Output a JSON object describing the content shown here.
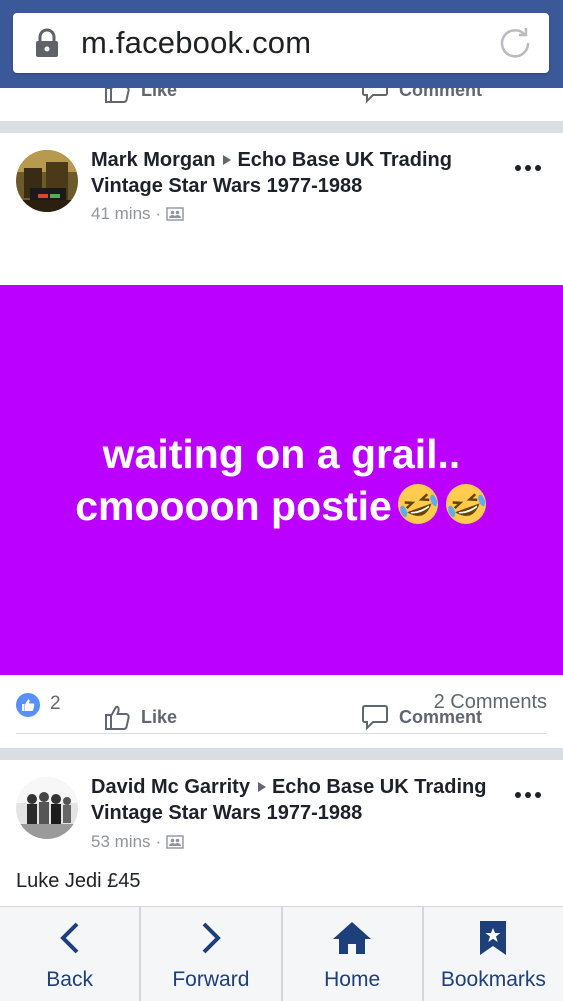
{
  "browser": {
    "url": "m.facebook.com"
  },
  "partial_post_actions": {
    "like_label": "Like",
    "comment_label": "Comment"
  },
  "post1": {
    "author": "Mark Morgan",
    "group": "Echo Base UK Trading",
    "group_line2": "Vintage Star Wars 1977-1988",
    "time": "41 mins",
    "text_line1": "waiting on a grail..",
    "text_line2": "cmoooon postie",
    "background_color": "#bb00ff",
    "emoji": [
      "rolling-on-floor-laughing",
      "rolling-on-floor-laughing"
    ],
    "like_count": "2",
    "comment_count": "2 Comments",
    "like_label": "Like",
    "comment_label": "Comment"
  },
  "post2": {
    "author": "David Mc Garrity",
    "group": "Echo Base UK Trading",
    "group_line2": "Vintage Star Wars 1977-1988",
    "time": "53 mins",
    "body": "Luke Jedi £45"
  },
  "bottom_nav": {
    "items": [
      {
        "label": "Back",
        "icon": "chevron-left-icon"
      },
      {
        "label": "Forward",
        "icon": "chevron-right-icon"
      },
      {
        "label": "Home",
        "icon": "home-icon"
      },
      {
        "label": "Bookmarks",
        "icon": "bookmark-icon"
      }
    ]
  },
  "colors": {
    "brand": "#3b5998",
    "nav_text": "#1d3f7a",
    "like_blue": "#5890ff"
  }
}
